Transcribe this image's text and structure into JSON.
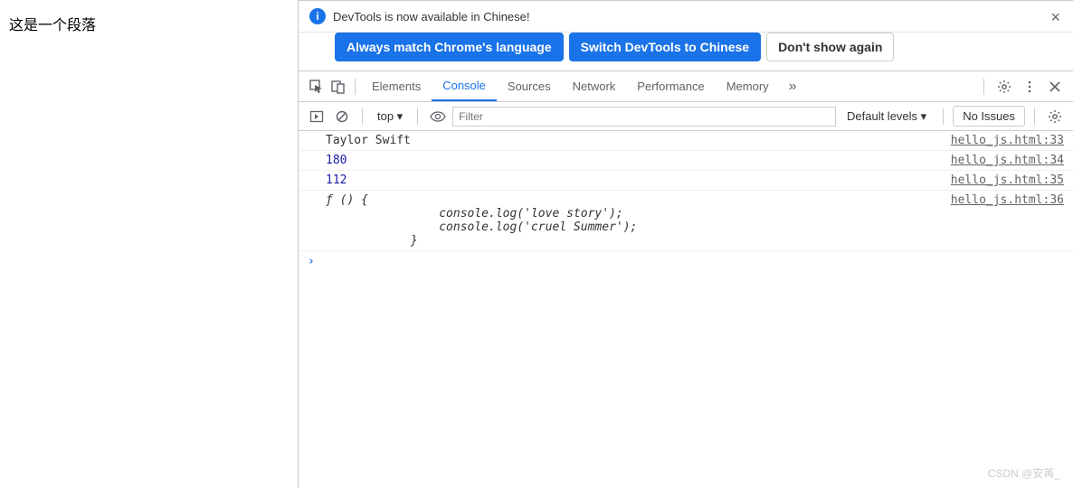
{
  "page": {
    "paragraph": "这是一个段落"
  },
  "banner": {
    "message": "DevTools is now available in Chinese!",
    "btn_match": "Always match Chrome's language",
    "btn_switch": "Switch DevTools to Chinese",
    "btn_dismiss": "Don't show again"
  },
  "tabs": {
    "elements": "Elements",
    "console": "Console",
    "sources": "Sources",
    "network": "Network",
    "performance": "Performance",
    "memory": "Memory"
  },
  "toolbar": {
    "context": "top ▾",
    "filter_placeholder": "Filter",
    "levels": "Default levels ▾",
    "issues": "No Issues"
  },
  "console": {
    "logs": [
      {
        "text": "Taylor Swift",
        "type": "string",
        "source": "hello_js.html:33"
      },
      {
        "text": "180",
        "type": "number",
        "source": "hello_js.html:34"
      },
      {
        "text": "112",
        "type": "number",
        "source": "hello_js.html:35"
      },
      {
        "text": "ƒ () {\n                console.log('love story');\n                console.log('cruel Summer');\n            }",
        "type": "function",
        "source": "hello_js.html:36"
      }
    ]
  },
  "watermark": "CSDN @安苒_"
}
